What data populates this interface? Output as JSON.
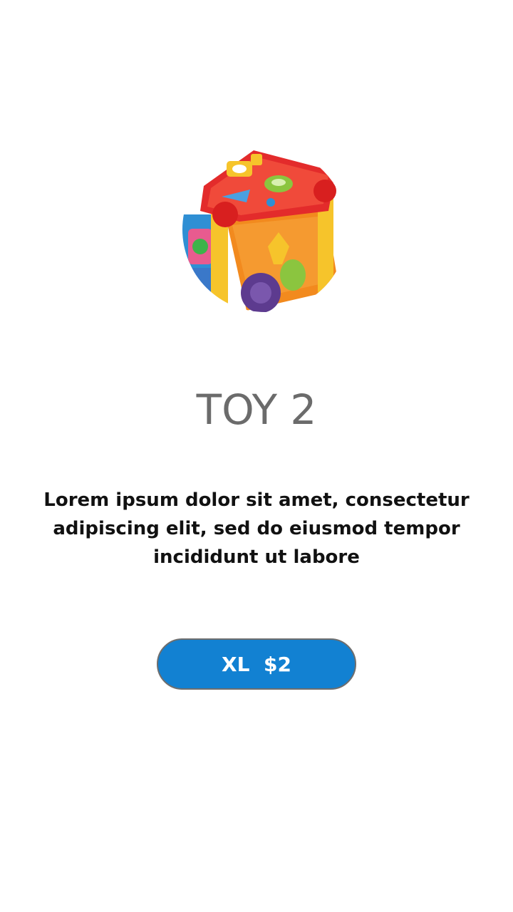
{
  "product": {
    "image_name": "toy-activity-cube",
    "title": "TOY 2",
    "description": "Lorem ipsum dolor sit amet, consectetur adipiscing elit, sed do eiusmod tempor incididunt ut labore",
    "size_label": "XL",
    "price_label": "$2"
  },
  "colors": {
    "accent": "#1281d2",
    "title_text": "#6b6b6b",
    "body_text": "#111111",
    "background": "#ffffff"
  }
}
